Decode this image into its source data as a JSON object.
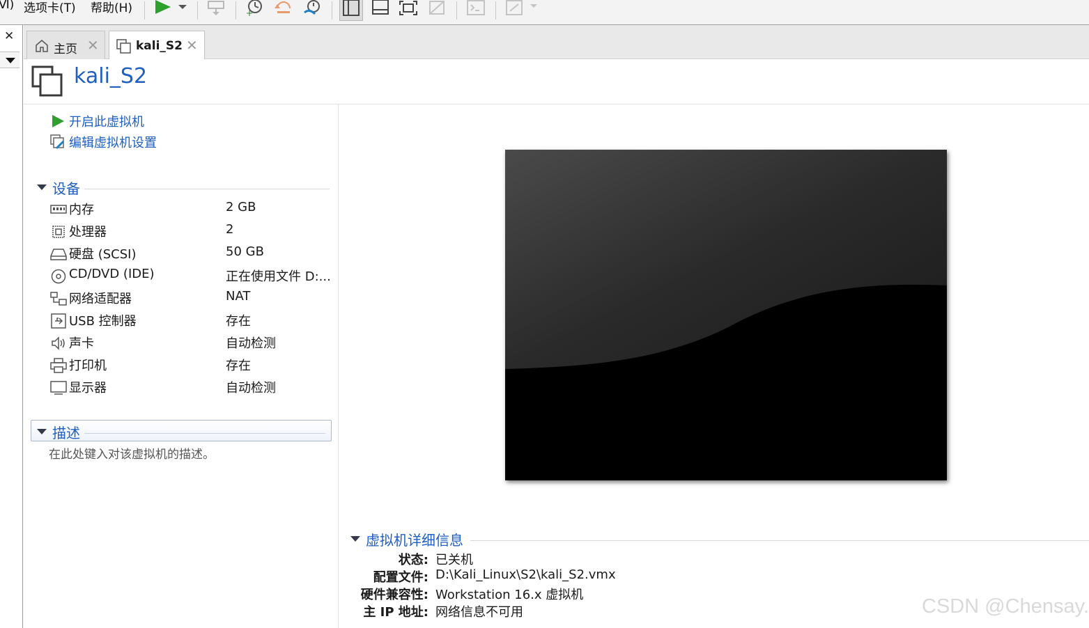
{
  "menu": {
    "partial_item": "Ⅵ)",
    "tabs_menu": "选项卡(T)",
    "help_menu": "帮助(H)"
  },
  "tabs": [
    {
      "label": "主页",
      "close": "✕"
    },
    {
      "label": "kali_S2",
      "close": "✕"
    }
  ],
  "sidebar": {
    "close": "✕"
  },
  "vm": {
    "name": "kali_S2"
  },
  "actions": {
    "power_on": "开启此虚拟机",
    "edit_settings": "编辑虚拟机设置"
  },
  "devices": {
    "title": "设备",
    "items": [
      {
        "name": "内存",
        "value": "2 GB",
        "icon": "memory-icon"
      },
      {
        "name": "处理器",
        "value": "2",
        "icon": "cpu-icon"
      },
      {
        "name": "硬盘 (SCSI)",
        "value": "50 GB",
        "icon": "hard-disk-icon"
      },
      {
        "name": "CD/DVD (IDE)",
        "value": "正在使用文件 D:...",
        "icon": "cd-dvd-icon"
      },
      {
        "name": "网络适配器",
        "value": "NAT",
        "icon": "network-adapter-icon"
      },
      {
        "name": "USB 控制器",
        "value": "存在",
        "icon": "usb-icon"
      },
      {
        "name": "声卡",
        "value": "自动检测",
        "icon": "sound-icon"
      },
      {
        "name": "打印机",
        "value": "存在",
        "icon": "printer-icon"
      },
      {
        "name": "显示器",
        "value": "自动检测",
        "icon": "monitor-icon"
      }
    ]
  },
  "description": {
    "title": "描述",
    "placeholder": "在此处键入对该虚拟机的描述。"
  },
  "details": {
    "title": "虚拟机详细信息",
    "rows": [
      {
        "key": "状态:",
        "value": "已关机"
      },
      {
        "key": "配置文件:",
        "value": "D:\\Kali_Linux\\S2\\kali_S2.vmx"
      },
      {
        "key": "硬件兼容性:",
        "value": "Workstation 16.x 虚拟机"
      },
      {
        "key": "主 IP 地址:",
        "value": "网络信息不可用"
      }
    ]
  },
  "watermark": "CSDN @Chensay.",
  "colors": {
    "accent": "#1f5fbf",
    "play_green": "#2ea02e"
  }
}
